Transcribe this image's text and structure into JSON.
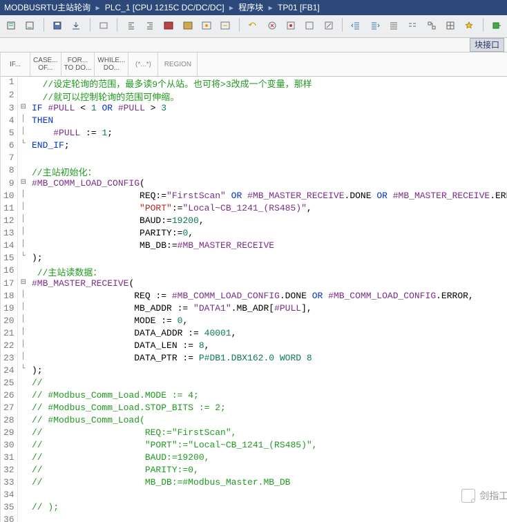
{
  "title": {
    "parts": [
      "MODBUSRTU主站轮询",
      "PLC_1 [CPU 1215C DC/DC/DC]",
      "程序块",
      "TP01 [FB1]"
    ]
  },
  "interface_tab": "块接口",
  "exprbar": [
    {
      "l1": "IF..."
    },
    {
      "l1": "CASE...",
      "l2": "OF..."
    },
    {
      "l1": "FOR...",
      "l2": "TO DO..."
    },
    {
      "l1": "WHILE...",
      "l2": "DO..."
    },
    {
      "l1": "(*...*)"
    },
    {
      "l1": "REGION"
    }
  ],
  "watermark": "剑指工控",
  "code": [
    {
      "n": 1,
      "fold": "",
      "tokens": [
        {
          "t": "  ",
          "c": ""
        },
        {
          "t": "//设定轮询的范围，最多读9个从站。也可将>3改成一个变量，那样",
          "c": "c-comment"
        }
      ]
    },
    {
      "n": 2,
      "fold": "",
      "tokens": [
        {
          "t": "  ",
          "c": ""
        },
        {
          "t": "//就可以控制轮询的范围可伸缩。",
          "c": "c-comment"
        }
      ]
    },
    {
      "n": 3,
      "fold": "⊟",
      "tokens": [
        {
          "t": "IF ",
          "c": "c-kw"
        },
        {
          "t": "#PULL",
          "c": "c-var"
        },
        {
          "t": " < ",
          "c": ""
        },
        {
          "t": "1",
          "c": "c-num"
        },
        {
          "t": " OR ",
          "c": "c-kw"
        },
        {
          "t": "#PULL",
          "c": "c-var"
        },
        {
          "t": " > ",
          "c": ""
        },
        {
          "t": "3",
          "c": "c-num"
        }
      ]
    },
    {
      "n": 4,
      "fold": "│",
      "tokens": [
        {
          "t": "THEN",
          "c": "c-kw"
        }
      ]
    },
    {
      "n": 5,
      "fold": "│",
      "tokens": [
        {
          "t": "    ",
          "c": ""
        },
        {
          "t": "#PULL",
          "c": "c-var"
        },
        {
          "t": " := ",
          "c": ""
        },
        {
          "t": "1",
          "c": "c-num"
        },
        {
          "t": ";",
          "c": ""
        }
      ]
    },
    {
      "n": 6,
      "fold": "└",
      "tokens": [
        {
          "t": "END_IF",
          "c": "c-kw"
        },
        {
          "t": ";",
          "c": ""
        }
      ]
    },
    {
      "n": 7,
      "fold": "",
      "tokens": [
        {
          "t": "",
          "c": ""
        }
      ]
    },
    {
      "n": 8,
      "fold": "",
      "tokens": [
        {
          "t": "//主站初始化：",
          "c": "c-comment"
        }
      ]
    },
    {
      "n": 9,
      "fold": "⊟",
      "tokens": [
        {
          "t": "#MB_COMM_LOAD_CONFIG",
          "c": "c-var"
        },
        {
          "t": "(",
          "c": ""
        }
      ]
    },
    {
      "n": 10,
      "fold": "│",
      "tokens": [
        {
          "t": "                    REQ:=",
          "c": ""
        },
        {
          "t": "\"FirstScan\"",
          "c": "c-id"
        },
        {
          "t": " OR ",
          "c": "c-kw"
        },
        {
          "t": "#MB_MASTER_RECEIVE",
          "c": "c-var"
        },
        {
          "t": ".DONE ",
          "c": ""
        },
        {
          "t": "OR ",
          "c": "c-kw"
        },
        {
          "t": "#MB_MASTER_RECEIVE",
          "c": "c-var"
        },
        {
          "t": ".ERROR,",
          "c": ""
        }
      ]
    },
    {
      "n": 11,
      "fold": "│",
      "tokens": [
        {
          "t": "                    ",
          "c": ""
        },
        {
          "t": "\"PORT\"",
          "c": "c-str"
        },
        {
          "t": ":=",
          "c": ""
        },
        {
          "t": "\"Local~CB_1241_(RS485)\"",
          "c": "c-id"
        },
        {
          "t": ",",
          "c": ""
        }
      ]
    },
    {
      "n": 12,
      "fold": "│",
      "tokens": [
        {
          "t": "                    BAUD:=",
          "c": ""
        },
        {
          "t": "19200",
          "c": "c-num"
        },
        {
          "t": ",",
          "c": ""
        }
      ]
    },
    {
      "n": 13,
      "fold": "│",
      "tokens": [
        {
          "t": "                    PARITY:=",
          "c": ""
        },
        {
          "t": "0",
          "c": "c-num"
        },
        {
          "t": ",",
          "c": ""
        }
      ]
    },
    {
      "n": 14,
      "fold": "│",
      "tokens": [
        {
          "t": "                    MB_DB:=",
          "c": ""
        },
        {
          "t": "#MB_MASTER_RECEIVE",
          "c": "c-var"
        }
      ]
    },
    {
      "n": 15,
      "fold": "└",
      "tokens": [
        {
          "t": ");",
          "c": ""
        }
      ]
    },
    {
      "n": 16,
      "fold": "",
      "tokens": [
        {
          "t": " ",
          "c": ""
        },
        {
          "t": "//主站读数据：",
          "c": "c-comment"
        }
      ]
    },
    {
      "n": 17,
      "fold": "⊟",
      "tokens": [
        {
          "t": "#MB_MASTER_RECEIVE",
          "c": "c-var"
        },
        {
          "t": "(",
          "c": ""
        }
      ]
    },
    {
      "n": 18,
      "fold": "│",
      "tokens": [
        {
          "t": "                   REQ := ",
          "c": ""
        },
        {
          "t": "#MB_COMM_LOAD_CONFIG",
          "c": "c-var"
        },
        {
          "t": ".DONE ",
          "c": ""
        },
        {
          "t": "OR ",
          "c": "c-kw"
        },
        {
          "t": "#MB_COMM_LOAD_CONFIG",
          "c": "c-var"
        },
        {
          "t": ".ERROR,",
          "c": ""
        }
      ]
    },
    {
      "n": 19,
      "fold": "│",
      "tokens": [
        {
          "t": "                   MB_ADDR := ",
          "c": ""
        },
        {
          "t": "\"DATA1\"",
          "c": "c-id"
        },
        {
          "t": ".MB_ADR[",
          "c": ""
        },
        {
          "t": "#PULL",
          "c": "c-var"
        },
        {
          "t": "],",
          "c": ""
        }
      ]
    },
    {
      "n": 20,
      "fold": "│",
      "tokens": [
        {
          "t": "                   MODE := ",
          "c": ""
        },
        {
          "t": "0",
          "c": "c-num"
        },
        {
          "t": ",",
          "c": ""
        }
      ]
    },
    {
      "n": 21,
      "fold": "│",
      "tokens": [
        {
          "t": "                   DATA_ADDR := ",
          "c": ""
        },
        {
          "t": "40001",
          "c": "c-num"
        },
        {
          "t": ",",
          "c": ""
        }
      ]
    },
    {
      "n": 22,
      "fold": "│",
      "tokens": [
        {
          "t": "                   DATA_LEN := ",
          "c": ""
        },
        {
          "t": "8",
          "c": "c-num"
        },
        {
          "t": ",",
          "c": ""
        }
      ]
    },
    {
      "n": 23,
      "fold": "│",
      "tokens": [
        {
          "t": "                   DATA_PTR := ",
          "c": ""
        },
        {
          "t": "P#DB1.DBX162.0 WORD 8",
          "c": "c-num"
        }
      ]
    },
    {
      "n": 24,
      "fold": "└",
      "tokens": [
        {
          "t": ");",
          "c": ""
        }
      ]
    },
    {
      "n": 25,
      "fold": "",
      "tokens": [
        {
          "t": "//",
          "c": "c-comment"
        }
      ]
    },
    {
      "n": 26,
      "fold": "",
      "tokens": [
        {
          "t": "// #Modbus_Comm_Load.MODE := 4;",
          "c": "c-comment"
        }
      ]
    },
    {
      "n": 27,
      "fold": "",
      "tokens": [
        {
          "t": "// #Modbus_Comm_Load.STOP_BITS := 2;",
          "c": "c-comment"
        }
      ]
    },
    {
      "n": 28,
      "fold": "",
      "tokens": [
        {
          "t": "// #Modbus_Comm_Load(",
          "c": "c-comment"
        }
      ]
    },
    {
      "n": 29,
      "fold": "",
      "tokens": [
        {
          "t": "//                   REQ:=\"FirstScan\",",
          "c": "c-comment"
        }
      ]
    },
    {
      "n": 30,
      "fold": "",
      "tokens": [
        {
          "t": "//                   \"PORT\":=\"Local~CB_1241_(RS485)\",",
          "c": "c-comment"
        }
      ]
    },
    {
      "n": 31,
      "fold": "",
      "tokens": [
        {
          "t": "//                   BAUD:=19200,",
          "c": "c-comment"
        }
      ]
    },
    {
      "n": 32,
      "fold": "",
      "tokens": [
        {
          "t": "//                   PARITY:=0,",
          "c": "c-comment"
        }
      ]
    },
    {
      "n": 33,
      "fold": "",
      "tokens": [
        {
          "t": "//                   MB_DB:=#Modbus_Master.MB_DB",
          "c": "c-comment"
        }
      ]
    },
    {
      "n": 34,
      "fold": "",
      "tokens": [
        {
          "t": "",
          "c": ""
        }
      ]
    },
    {
      "n": 35,
      "fold": "",
      "tokens": [
        {
          "t": "// );",
          "c": "c-comment"
        }
      ]
    },
    {
      "n": 36,
      "fold": "",
      "tokens": [
        {
          "t": "",
          "c": ""
        }
      ]
    }
  ]
}
